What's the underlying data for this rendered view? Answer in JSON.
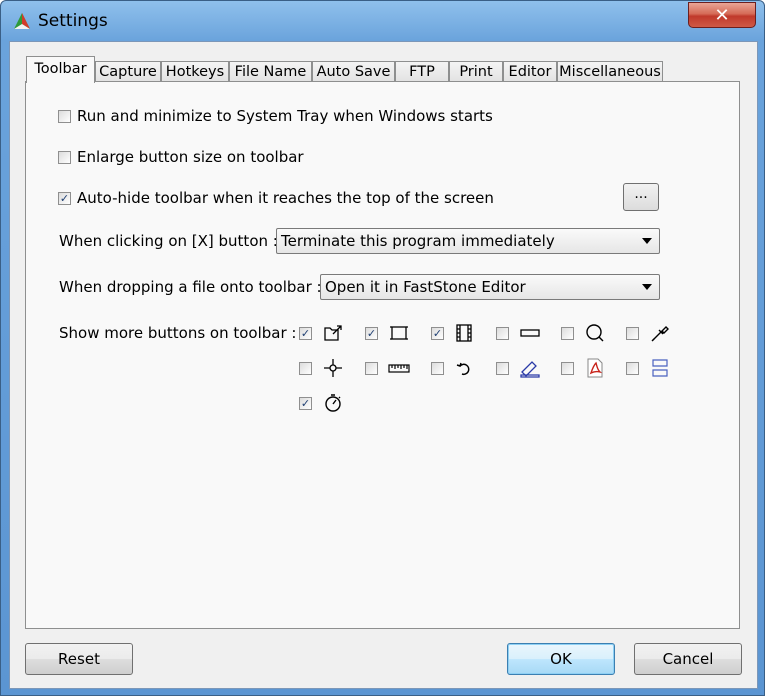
{
  "window": {
    "title": "Settings",
    "close_glyph": "✕"
  },
  "tabs": [
    {
      "label": "Toolbar",
      "active": true
    },
    {
      "label": "Capture"
    },
    {
      "label": "Hotkeys"
    },
    {
      "label": "File Name"
    },
    {
      "label": "Auto Save"
    },
    {
      "label": "FTP"
    },
    {
      "label": "Print"
    },
    {
      "label": "Editor"
    },
    {
      "label": "Miscellaneous"
    }
  ],
  "options": {
    "run_minimize": {
      "label": "Run and minimize to System Tray when Windows starts",
      "checked": false
    },
    "enlarge": {
      "label": "Enlarge button size on toolbar",
      "checked": false
    },
    "auto_hide": {
      "label": "Auto-hide toolbar when it reaches the top of the screen",
      "checked": true
    },
    "dots_button": "..."
  },
  "x_button": {
    "label": "When clicking on [X] button :",
    "value": "Terminate this program immediately"
  },
  "drop_file": {
    "label": "When dropping a file onto toolbar :",
    "value": "Open it in FastStone Editor"
  },
  "more_buttons": {
    "label": "Show more buttons on toolbar :",
    "items": [
      {
        "icon": "open-file-icon",
        "checked": true
      },
      {
        "icon": "capture-rectangle-icon",
        "checked": true
      },
      {
        "icon": "filmstrip-icon",
        "checked": true
      },
      {
        "icon": "window-bar-icon",
        "checked": false
      },
      {
        "icon": "magnifier-icon",
        "checked": false
      },
      {
        "icon": "color-picker-icon",
        "checked": false
      },
      {
        "icon": "crosshair-icon",
        "checked": false
      },
      {
        "icon": "ruler-icon",
        "checked": false
      },
      {
        "icon": "repeat-icon",
        "checked": false
      },
      {
        "icon": "scanner-icon",
        "checked": false
      },
      {
        "icon": "pdf-icon",
        "checked": false
      },
      {
        "icon": "split-window-icon",
        "checked": false
      },
      {
        "icon": "timer-icon",
        "checked": true
      }
    ]
  },
  "buttons": {
    "reset": "Reset",
    "ok": "OK",
    "cancel": "Cancel"
  },
  "check_glyph": "✓"
}
